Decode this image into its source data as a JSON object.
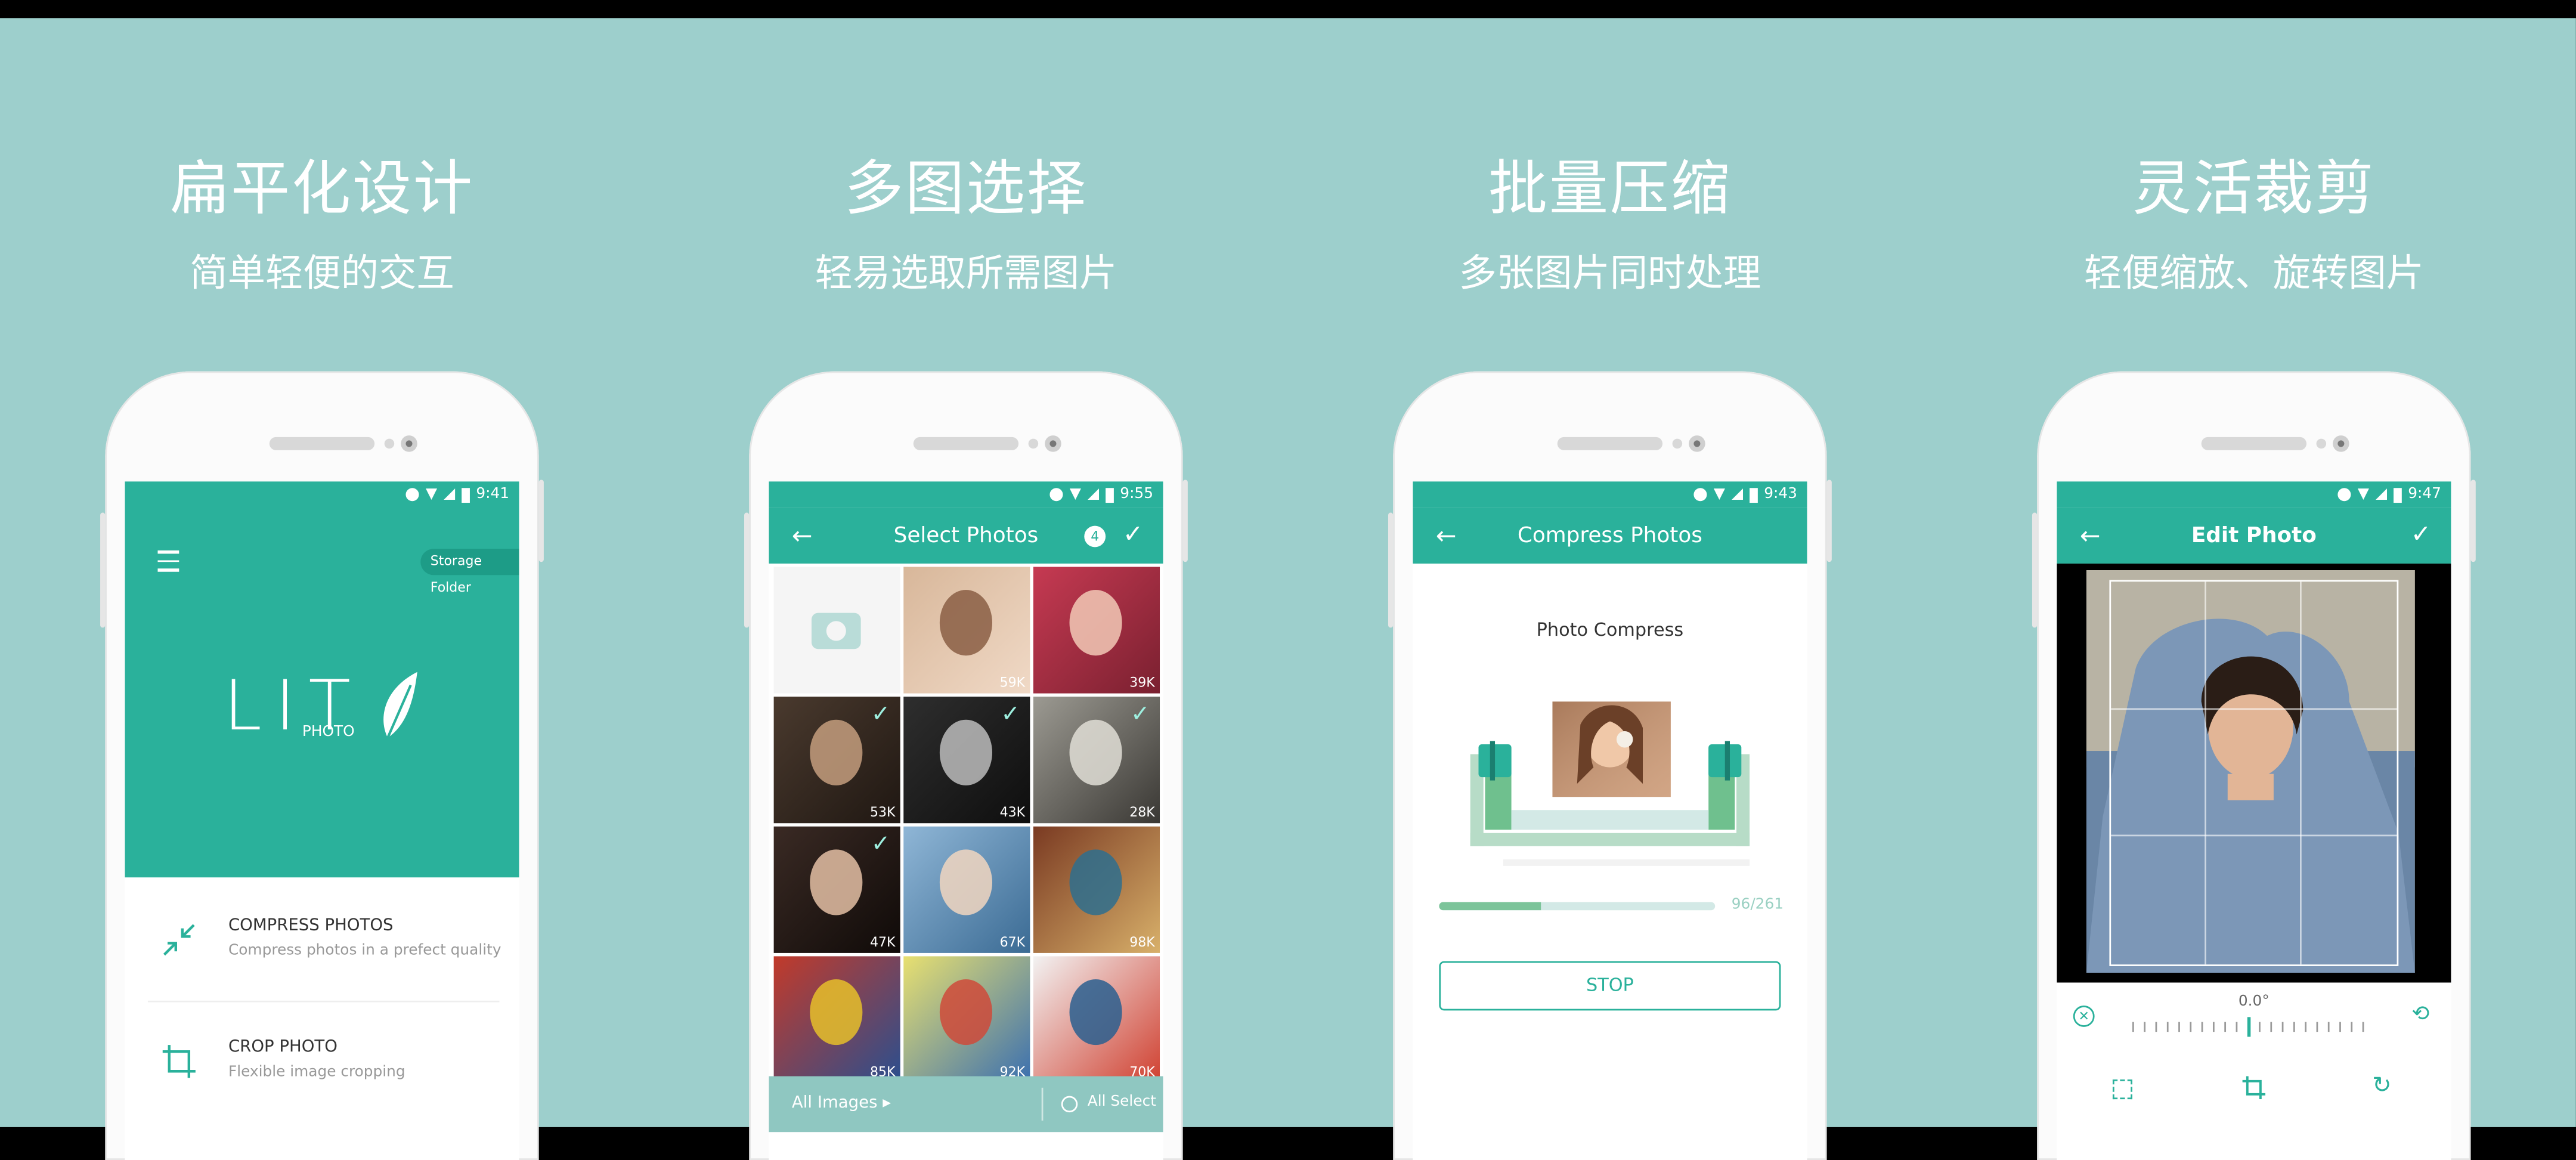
{
  "colors": {
    "accent": "#2ab19b",
    "background": "#9dcfcc",
    "progress": "#7cc49a"
  },
  "panels": [
    {
      "title": "扁平化设计",
      "subtitle": "简单轻便的交互"
    },
    {
      "title": "多图选择",
      "subtitle": "轻易选取所需图片"
    },
    {
      "title": "批量压缩",
      "subtitle": "多张图片同时处理"
    },
    {
      "title": "灵活裁剪",
      "subtitle": "轻便缩放、旋转图片"
    }
  ],
  "home": {
    "time": "9:41",
    "storage_label": "Storage Folder",
    "logo_main": "LIT",
    "logo_sub": "PHOTO",
    "menu_icon": "hamburger-icon",
    "items": [
      {
        "title": "COMPRESS PHOTOS",
        "desc": "Compress photos in a prefect quality",
        "icon": "compress-icon"
      },
      {
        "title": "CROP PHOTO",
        "desc": "Flexible image cropping",
        "icon": "crop-icon"
      }
    ]
  },
  "select": {
    "time": "9:55",
    "title": "Select Photos",
    "count": "4",
    "tiles": [
      {
        "size": "",
        "checked": false
      },
      {
        "size": "59K",
        "checked": false
      },
      {
        "size": "39K",
        "checked": false
      },
      {
        "size": "53K",
        "checked": true
      },
      {
        "size": "43K",
        "checked": true
      },
      {
        "size": "28K",
        "checked": true
      },
      {
        "size": "47K",
        "checked": true
      },
      {
        "size": "67K",
        "checked": false
      },
      {
        "size": "98K",
        "checked": false
      },
      {
        "size": "85K",
        "checked": false
      },
      {
        "size": "92K",
        "checked": false
      },
      {
        "size": "70K",
        "checked": false
      }
    ],
    "album": "All Images",
    "select_all": "All Select"
  },
  "compress": {
    "time": "9:43",
    "title": "Compress Photos",
    "label": "Photo Compress",
    "progress_text": "96/261",
    "progress": 0.37,
    "stop_label": "STOP"
  },
  "edit": {
    "time": "9:47",
    "title": "Edit Photo",
    "angle": "0.0°"
  }
}
